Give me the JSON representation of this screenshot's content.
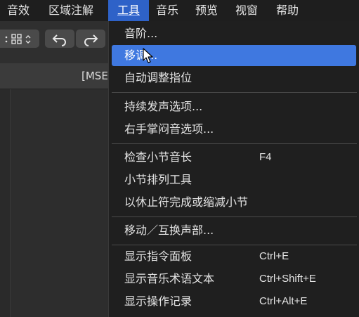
{
  "menubar": {
    "items": [
      {
        "label": "音效"
      },
      {
        "label": "区域注解"
      },
      {
        "label": "工具"
      },
      {
        "label": "音乐"
      },
      {
        "label": "预览"
      },
      {
        "label": "视窗"
      },
      {
        "label": "帮助"
      }
    ],
    "active_index": 2
  },
  "toolbar": {
    "layout_icon": "grid-icon",
    "undo_icon": "undo-icon",
    "redo_icon": "redo-icon"
  },
  "score_window": {
    "title_partial": "[MSE"
  },
  "tools_menu": {
    "items": [
      {
        "label": "音阶...",
        "shortcut": ""
      },
      {
        "label": "移调...",
        "shortcut": ""
      },
      {
        "label": "自动调整指位",
        "shortcut": ""
      },
      {
        "label": "持续发声选项...",
        "shortcut": ""
      },
      {
        "label": "右手掌闷音选项...",
        "shortcut": ""
      },
      {
        "label": "检查小节音长",
        "shortcut": "F4"
      },
      {
        "label": "小节排列工具",
        "shortcut": ""
      },
      {
        "label": "以休止符完成或缩减小节",
        "shortcut": ""
      },
      {
        "label": "移动／互换声部...",
        "shortcut": ""
      },
      {
        "label": "显示指令面板",
        "shortcut": "Ctrl+E"
      },
      {
        "label": "显示音乐术语文本",
        "shortcut": "Ctrl+Shift+E"
      },
      {
        "label": "显示操作记录",
        "shortcut": "Ctrl+Alt+E"
      }
    ],
    "hovered_index": 1
  },
  "colors": {
    "menu_active": "#2e62c8",
    "item_hover": "#3f78e0",
    "menu_bg": "#1f1f1f"
  }
}
